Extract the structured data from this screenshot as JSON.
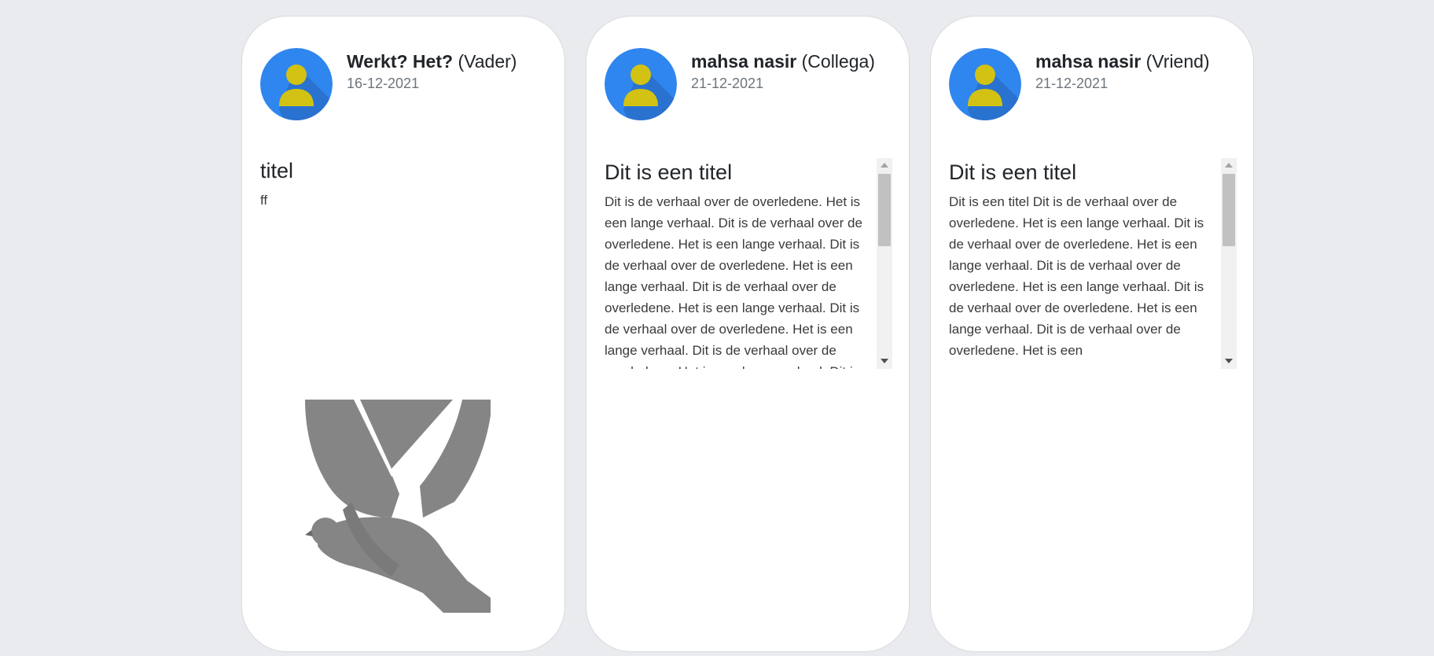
{
  "cards": [
    {
      "author": "Werkt? Het?",
      "relation": "(Vader)",
      "date": "16-12-2021",
      "title": "titel",
      "body": "ff",
      "avatar_icon": "user-avatar-icon",
      "image_icon": "dove-icon"
    },
    {
      "author": "mahsa nasir",
      "relation": "(Collega)",
      "date": "21-12-2021",
      "title": "Dit is een titel",
      "body": "Dit is de verhaal over de overledene. Het is een lange verhaal. Dit is de verhaal over de overledene. Het is een lange verhaal. Dit is de verhaal over de overledene. Het is een lange verhaal. Dit is de verhaal over de overledene. Het is een lange verhaal. Dit is de verhaal over de overledene. Het is een lange verhaal. Dit is de verhaal over de overledene. Het is een lange verhaal. Dit is",
      "avatar_icon": "user-avatar-icon"
    },
    {
      "author": "mahsa nasir",
      "relation": "(Vriend)",
      "date": "21-12-2021",
      "title": "Dit is een titel",
      "body": "Dit is een titel Dit is de verhaal over de overledene. Het is een lange verhaal. Dit is de verhaal over de overledene. Het is een lange verhaal. Dit is de verhaal over de overledene. Het is een lange verhaal. Dit is de verhaal over de overledene. Het is een lange verhaal. Dit is de verhaal over de overledene. Het is een",
      "avatar_icon": "user-avatar-icon"
    }
  ],
  "colors": {
    "background": "#e9ebee",
    "avatar_blue": "#2f86ee",
    "avatar_person": "#d2c213",
    "date_gray": "#6c757d",
    "dove_gray": "#858585"
  }
}
